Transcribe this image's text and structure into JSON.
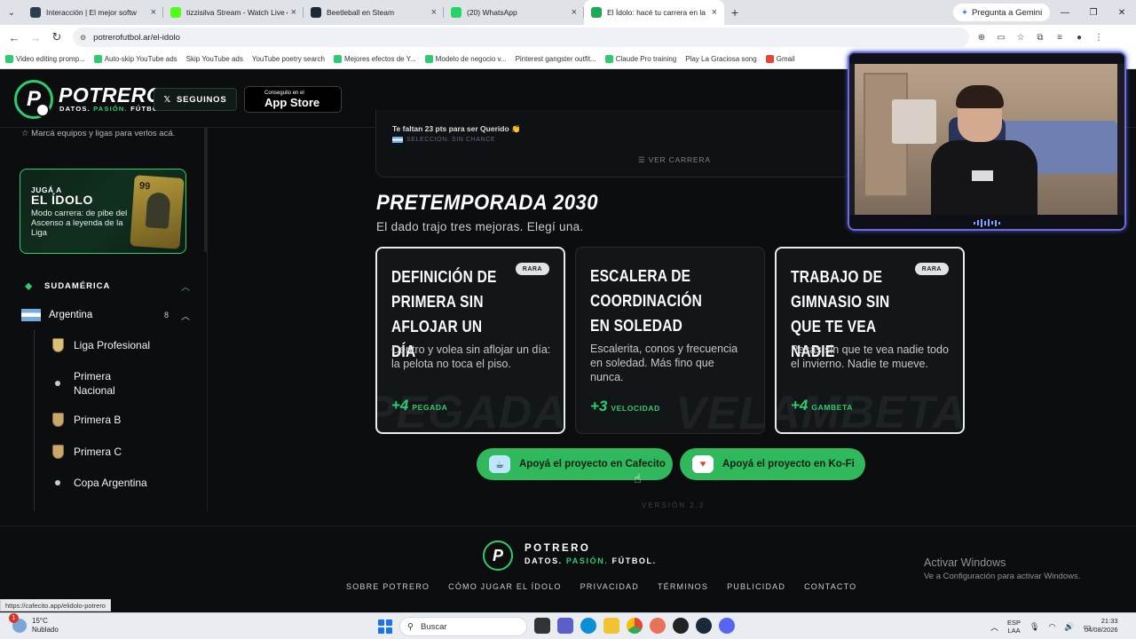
{
  "browser": {
    "tabs": [
      {
        "title": "Interacción | El mejor softw",
        "color": "#2c3e50",
        "active": false
      },
      {
        "title": "tizzisilva Stream - Watch Live o",
        "color": "#53fc18",
        "active": false
      },
      {
        "title": "Beetleball en Steam",
        "color": "#1b2838",
        "active": false
      },
      {
        "title": "(20) WhatsApp",
        "color": "#25d366",
        "active": false
      },
      {
        "title": "El Ídolo: hacé tu carrera en la Li",
        "color": "#1fa855",
        "active": true
      }
    ],
    "gemini_label": "Pregunta a Gemini",
    "url": "potrerofutbol.ar/el-idolo",
    "bookmarks": [
      {
        "label": "Video editing promp...",
        "color": "#2ecc71"
      },
      {
        "label": "Auto-skip YouTube ads",
        "color": "#2ecc71"
      },
      {
        "label": "Skip YouTube ads",
        "color": ""
      },
      {
        "label": "YouTube poetry search",
        "color": ""
      },
      {
        "label": "Mejores efectos de Y...",
        "color": "#2ecc71"
      },
      {
        "label": "Modelo de negocio v...",
        "color": "#2ecc71"
      },
      {
        "label": "Pinterest gangster outfit...",
        "color": ""
      },
      {
        "label": "Claude Pro training",
        "color": "#2ecc71"
      },
      {
        "label": "Play La Graciosa song",
        "color": ""
      },
      {
        "label": "Gmail",
        "color": "#ea4335"
      }
    ],
    "status_url": "https://cafecito.app/elidolo-potrero"
  },
  "header": {
    "logo_letter": "P",
    "brand": "POTRERO",
    "tagline_1": "DATOS. ",
    "tagline_2": "PASIÓN.",
    "tagline_3": " FÚTBOL.",
    "follow_label": "SEGUINOS",
    "appstore_small": "Conseguilo en el",
    "appstore_big": "App Store"
  },
  "sidebar": {
    "tip": "Marcá equipos y ligas para verlos acá.",
    "promo": {
      "line1": "JUGÁ A",
      "line2": "EL ÍDOLO",
      "desc": "Modo carrera: de pibe del Ascenso a leyenda de la Liga",
      "card_number": "99"
    },
    "region": "SUDAMÉRICA",
    "country": {
      "name": "Argentina",
      "count": "8"
    },
    "leagues": [
      {
        "name": "Liga Profesional",
        "icon": "trophy"
      },
      {
        "name": "Primera Nacional",
        "icon": "dot"
      },
      {
        "name": "Primera B",
        "icon": "shield"
      },
      {
        "name": "Primera C",
        "icon": "shield"
      },
      {
        "name": "Copa Argentina",
        "icon": "dot"
      }
    ]
  },
  "career": {
    "line1": "Te faltan 23 pts para ser Querido 👏",
    "line2": "SELECCIÓN: SIN CHANCE",
    "view_career": "VER CARRERA"
  },
  "season": {
    "title": "PRETEMPORADA 2030",
    "subtitle": "El dado trajo tres mejoras. Elegí una.",
    "options": [
      {
        "title": "DEFINICIÓN DE PRIMERA SIN AFLOJAR UN DÍA",
        "badge": "RARA",
        "desc": "Centro y volea sin aflojar un día: la pelota no toca el piso.",
        "stat_value": "+4",
        "stat_name": "PEGADA",
        "watermark": "PEGADA",
        "selected": true
      },
      {
        "title": "ESCALERA DE COORDINACIÓN EN SOLEDAD",
        "badge": "",
        "desc": "Escalerita, conos y frecuencia en soledad. Más fino que nunca.",
        "stat_value": "+3",
        "stat_name": "VELOCIDAD",
        "watermark": "VEL",
        "selected": false
      },
      {
        "title": "TRABAJO DE GIMNASIO SIN QUE TE VEA NADIE",
        "badge": "RARA",
        "desc": "Pesas sin que te vea nadie todo el invierno. Nadie te mueve.",
        "stat_value": "+4",
        "stat_name": "GAMBETA",
        "watermark": "GAMBETA",
        "selected": true
      }
    ]
  },
  "support": {
    "cafecito": "Apoyá el proyecto en Cafecito",
    "kofi": "Apoyá el proyecto en Ko-Fi"
  },
  "version": "VERSIÓN 2.2",
  "footer": {
    "brand": "POTRERO",
    "links": [
      "SOBRE POTRERO",
      "CÓMO JUGAR EL ÍDOLO",
      "PRIVACIDAD",
      "TÉRMINOS",
      "PUBLICIDAD",
      "CONTACTO"
    ],
    "activate_title": "Activar Windows",
    "activate_sub": "Ve a Configuración para activar Windows."
  },
  "taskbar": {
    "temp": "15°C",
    "weather": "Nublado",
    "weather_badge": "1",
    "search": "Buscar",
    "lang1": "ESP",
    "lang2": "LAA",
    "time": "21:33",
    "date": "04/08/2026"
  },
  "colors": {
    "accent_green": "#2ecc71",
    "button_green": "#2fb85c",
    "background": "#0b0d0e"
  }
}
